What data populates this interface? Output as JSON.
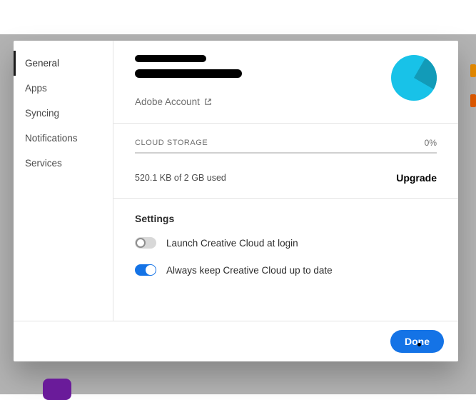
{
  "sidebar": {
    "items": [
      {
        "label": "General"
      },
      {
        "label": "Apps"
      },
      {
        "label": "Syncing"
      },
      {
        "label": "Notifications"
      },
      {
        "label": "Services"
      }
    ],
    "active_index": 0
  },
  "account": {
    "link_label": "Adobe Account"
  },
  "storage": {
    "section_label": "CLOUD STORAGE",
    "percent": "0%",
    "used_text": "520.1 KB of 2 GB used",
    "upgrade_label": "Upgrade"
  },
  "settings": {
    "title": "Settings",
    "rows": [
      {
        "label": "Launch Creative Cloud at login",
        "on": false
      },
      {
        "label": "Always keep Creative Cloud up to date",
        "on": true
      }
    ]
  },
  "footer": {
    "done_label": "Done"
  },
  "colors": {
    "accent": "#1473e6",
    "avatar_light": "#18c2e8",
    "avatar_dark": "#129bb8"
  }
}
